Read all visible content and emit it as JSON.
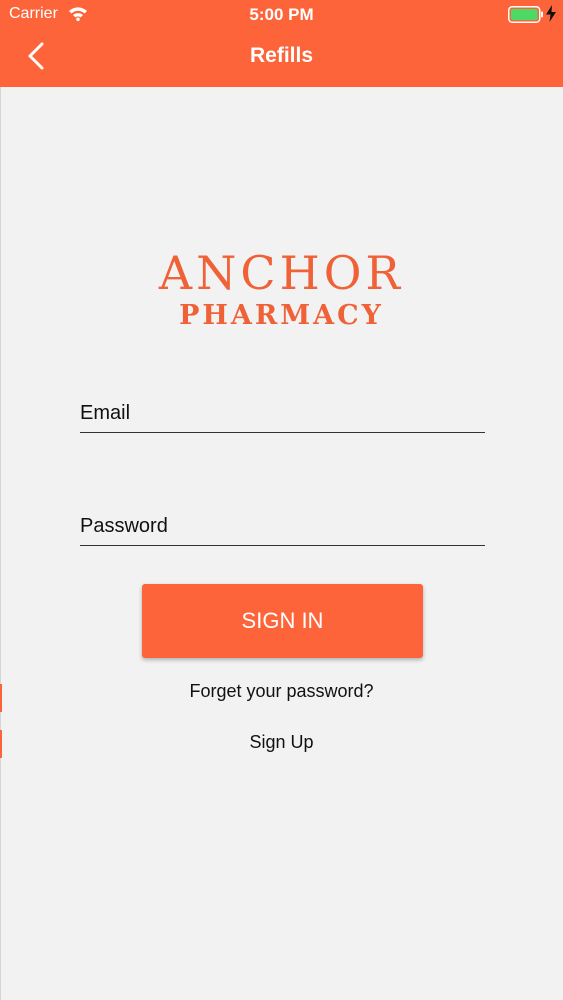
{
  "status_bar": {
    "carrier": "Carrier",
    "time": "5:00 PM",
    "wifi_icon": "wifi-icon",
    "battery_icon": "battery-icon",
    "charging_icon": "bolt-icon"
  },
  "nav": {
    "title": "Refills",
    "back_icon": "chevron-left-icon"
  },
  "logo": {
    "line1": "ANCHOR",
    "line2": "PHARMACY"
  },
  "form": {
    "email_placeholder": "Email",
    "email_value": "",
    "password_placeholder": "Password",
    "password_value": "",
    "sign_in_label": "SIGN IN",
    "forgot_label": "Forget your password?",
    "sign_up_label": "Sign Up"
  },
  "colors": {
    "accent": "#fe643a",
    "logo": "#ef6137",
    "background": "#f2f2f3",
    "battery_fill": "#4cd964"
  }
}
